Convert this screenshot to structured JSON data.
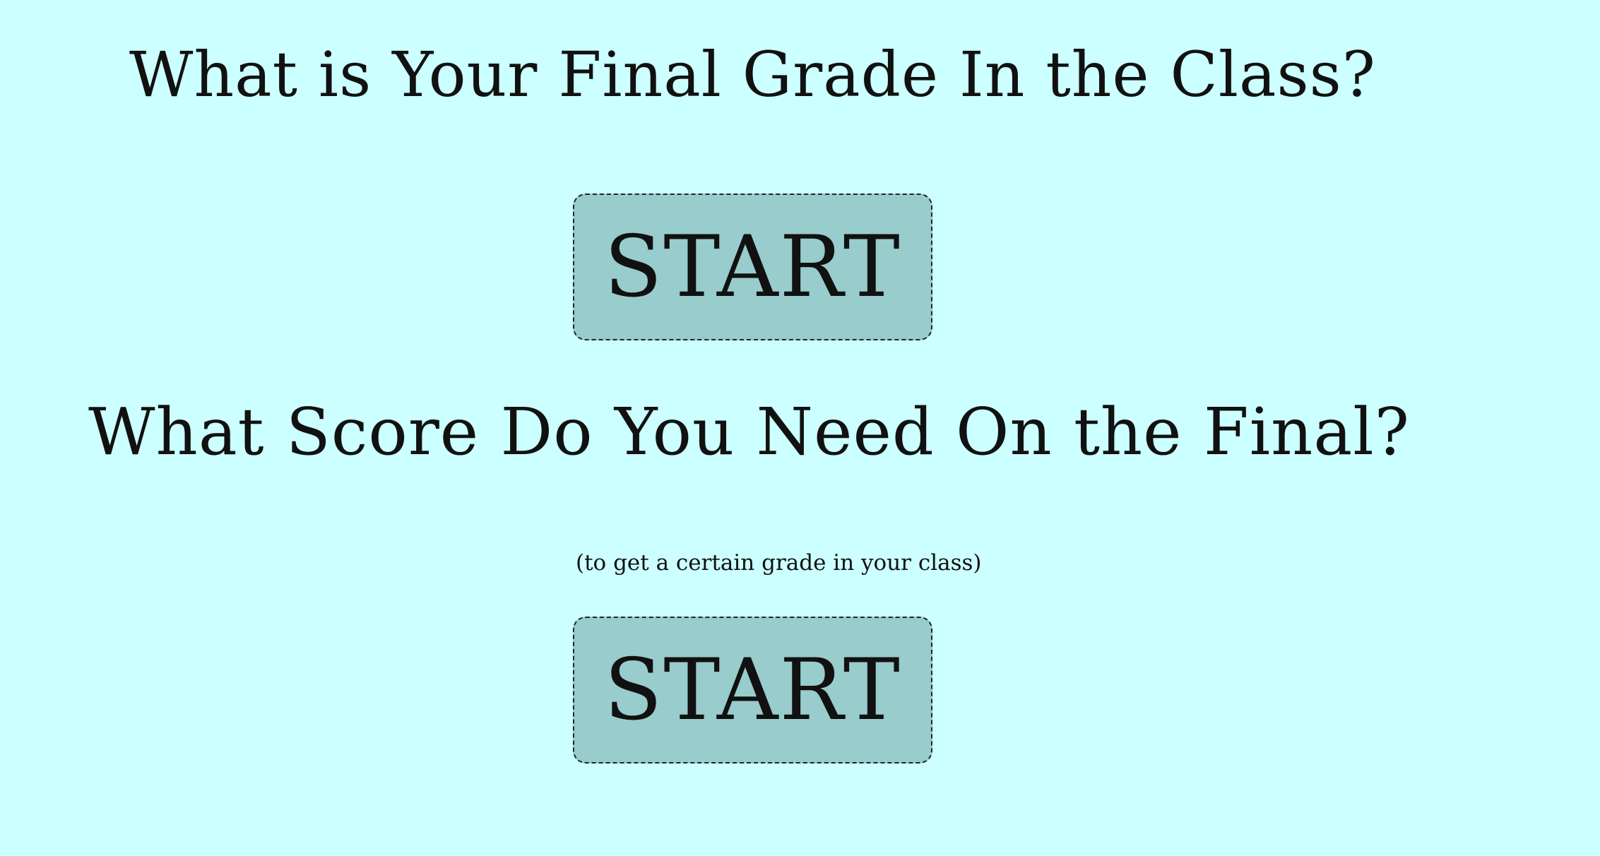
{
  "page": {
    "background_color": "#ccffff",
    "button_color": "#99cccc",
    "text_color": "#111111"
  },
  "section_final_grade": {
    "title": "What is Your Final Grade In the Class?",
    "start_label": "START"
  },
  "section_final_score": {
    "title": "What Score Do You Need On the Final?",
    "subtitle": "(to get a certain grade in your class)",
    "start_label": "START"
  }
}
